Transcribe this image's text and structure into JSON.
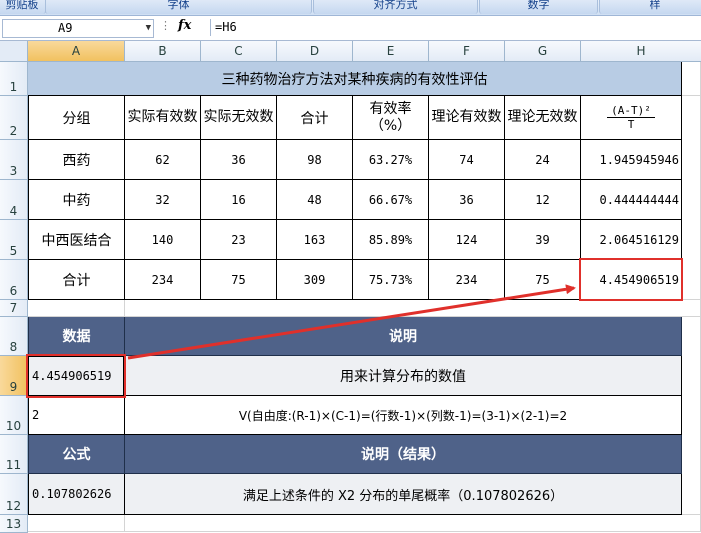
{
  "ribbon": {
    "groups": [
      "剪贴板",
      "字体",
      "对齐方式",
      "数字",
      "样"
    ]
  },
  "formula_bar": {
    "name_box": "A9",
    "fx_label": "fx",
    "formula": "=H6"
  },
  "columns": [
    "A",
    "B",
    "C",
    "D",
    "E",
    "F",
    "G",
    "H"
  ],
  "rows": [
    "1",
    "2",
    "3",
    "4",
    "5",
    "6",
    "7",
    "8",
    "9",
    "10",
    "11",
    "12",
    "13"
  ],
  "sheet": {
    "title": "三种药物治疗方法对某种疾病的有效性评估",
    "headers": [
      "分组",
      "实际有效数",
      "实际无效数",
      "合计",
      "有效率（%）",
      "理论有效数",
      "理论无效数"
    ],
    "h_header_top": "(A-T)²",
    "h_header_bottom": "T",
    "data_rows": [
      [
        "西药",
        "62",
        "36",
        "98",
        "63.27%",
        "74",
        "24",
        "1.945945946"
      ],
      [
        "中药",
        "32",
        "16",
        "48",
        "66.67%",
        "36",
        "12",
        "0.444444444"
      ],
      [
        "中西医结合",
        "140",
        "23",
        "163",
        "85.89%",
        "124",
        "39",
        "2.064516129"
      ],
      [
        "合计",
        "234",
        "75",
        "309",
        "75.73%",
        "234",
        "75",
        "4.454906519"
      ]
    ],
    "data_label": "数据",
    "desc_label": "说明",
    "value_a9": "4.454906519",
    "desc_9": "用来计算分布的数值",
    "value_a10": "2",
    "desc_10": "V(自由度:(R-1)×(C-1)=(行数-1)×(列数-1)=(3-1)×(2-1)=2",
    "formula_label": "公式",
    "result_label": "说明（结果）",
    "value_a12": "0.107802626",
    "desc_12": "满足上述条件的 X2 分布的单尾概率（0.107802626）"
  },
  "colors": {
    "accent_red": "#e0302b",
    "header_dark": "#4f6289",
    "title_band": "#b8cce4"
  }
}
